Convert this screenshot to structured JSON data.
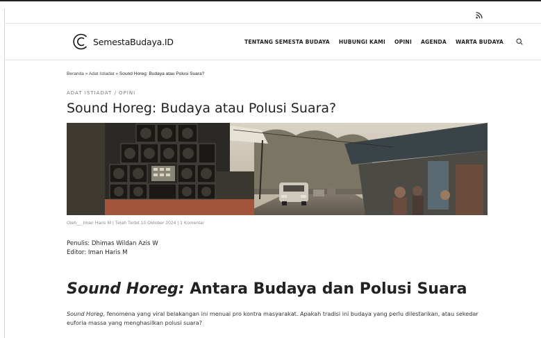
{
  "site": {
    "logo_text": "SemestaBudaya.ID"
  },
  "nav": {
    "items": [
      {
        "label": "TENTANG SEMESTA BUDAYA"
      },
      {
        "label": "HUBUNGI KAMI"
      },
      {
        "label": "OPINI"
      },
      {
        "label": "AGENDA"
      },
      {
        "label": "WARTA BUDAYA"
      }
    ]
  },
  "breadcrumb": {
    "home": "Beranda",
    "sep1": " » ",
    "section": "Adat Istiadat",
    "sep2": " » ",
    "current": "Sound Horeg: Budaya atau Polusi Suara?"
  },
  "article": {
    "category": "ADAT ISTIADAT / OPINI",
    "title": "Sound Horeg: Budaya atau Polusi Suara?",
    "meta": "Oleh__ Iman Haris M  |  Telah Terbit 10 Oktober 2024  |  1 Komentar",
    "writer": "Penulis: Dhimas Wildan Azis W",
    "editor": "Editor: Iman Haris M",
    "heading_italic": "Sound Horeg:",
    "heading_rest": " Antara Budaya dan Polusi Suara",
    "para_italic": "Sound Horeg",
    "para_rest": ", fenomena yang viral belakangan ini menuai pro kontra masyarakat. Apakah tradisi ini budaya yang perlu dilestarikan, atau sekedar euforia massa yang menghasilkan polusi suara?"
  },
  "colors": {
    "text": "#222222",
    "muted": "#888888",
    "divider": "#e2e2e2"
  }
}
